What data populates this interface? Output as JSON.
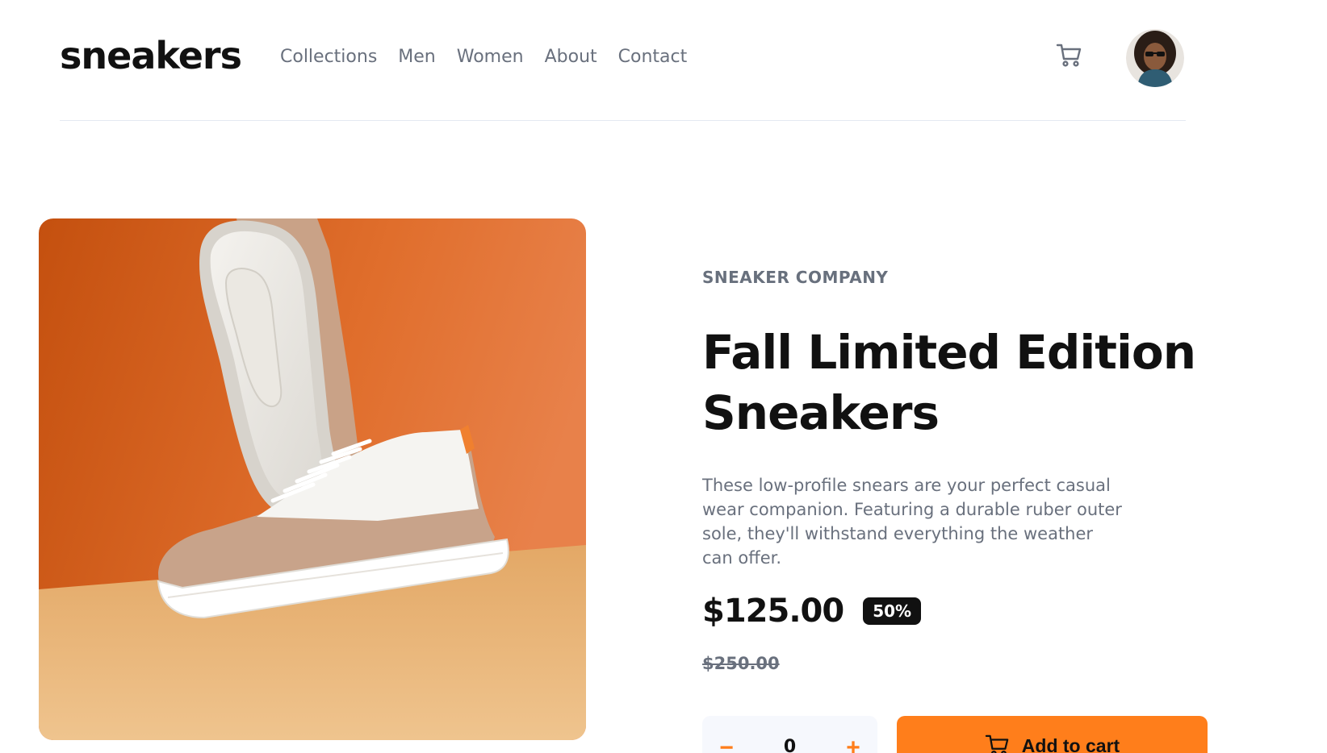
{
  "header": {
    "logo": "sneakers",
    "nav": [
      "Collections",
      "Men",
      "Women",
      "About",
      "Contact"
    ],
    "cart_icon": "cart-icon",
    "avatar_icon": "avatar"
  },
  "product": {
    "company": "SNEAKER COMPANY",
    "title": "Fall Limited Edition Sneakers",
    "description": "These low-profile snears are your perfect casual wear companion. Featuring a durable ruber outer sole, they'll withstand everything the weather can offer.",
    "price": "$125.00",
    "discount": "50%",
    "old_price": "$250.00"
  },
  "cart_controls": {
    "quantity": "0",
    "minus": "−",
    "plus": "+",
    "add_label": "Add to cart"
  },
  "colors": {
    "accent": "#ff7e1b",
    "text_dark": "#111111",
    "text_muted": "#69707d"
  }
}
